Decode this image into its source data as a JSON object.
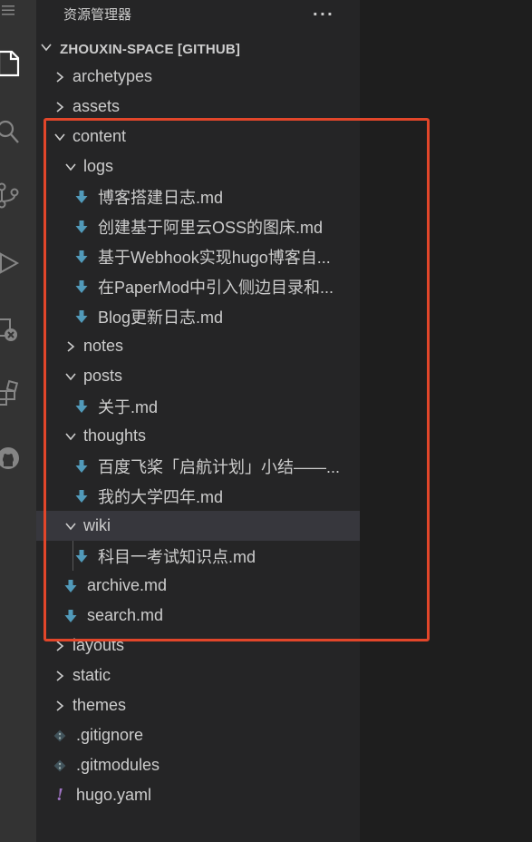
{
  "explorer": {
    "title": "资源管理器",
    "more_label": "···",
    "section_title": "ZHOUXIN-SPACE [GITHUB]"
  },
  "activity_bar": {
    "menu_icon": "hamburger-menu-icon",
    "items": [
      "explorer-icon",
      "search-icon",
      "source-control-icon",
      "run-debug-icon",
      "remote-explorer-icon",
      "extensions-icon",
      "github-icon"
    ]
  },
  "tree": [
    {
      "label": "archetypes",
      "type": "folder",
      "expanded": false,
      "depth": 0
    },
    {
      "label": "assets",
      "type": "folder",
      "expanded": false,
      "depth": 0
    },
    {
      "label": "content",
      "type": "folder",
      "expanded": true,
      "depth": 0
    },
    {
      "label": "logs",
      "type": "folder",
      "expanded": true,
      "depth": 1
    },
    {
      "label": "博客搭建日志.md",
      "type": "markdown",
      "depth": 2
    },
    {
      "label": "创建基于阿里云OSS的图床.md",
      "type": "markdown",
      "depth": 2
    },
    {
      "label": "基于Webhook实现hugo博客自...",
      "type": "markdown",
      "depth": 2
    },
    {
      "label": "在PaperMod中引入侧边目录和...",
      "type": "markdown",
      "depth": 2
    },
    {
      "label": "Blog更新日志.md",
      "type": "markdown",
      "depth": 2
    },
    {
      "label": "notes",
      "type": "folder",
      "expanded": false,
      "depth": 1
    },
    {
      "label": "posts",
      "type": "folder",
      "expanded": true,
      "depth": 1
    },
    {
      "label": "关于.md",
      "type": "markdown",
      "depth": 2
    },
    {
      "label": "thoughts",
      "type": "folder",
      "expanded": true,
      "depth": 1
    },
    {
      "label": "百度飞桨「启航计划」小结——...",
      "type": "markdown",
      "depth": 2
    },
    {
      "label": "我的大学四年.md",
      "type": "markdown",
      "depth": 2
    },
    {
      "label": "wiki",
      "type": "folder",
      "expanded": true,
      "depth": 1,
      "selected": true
    },
    {
      "label": "科目一考试知识点.md",
      "type": "markdown",
      "depth": 2
    },
    {
      "label": "archive.md",
      "type": "markdown",
      "depth": 1
    },
    {
      "label": "search.md",
      "type": "markdown",
      "depth": 1
    },
    {
      "label": "layouts",
      "type": "folder",
      "expanded": false,
      "depth": 0
    },
    {
      "label": "static",
      "type": "folder",
      "expanded": false,
      "depth": 0
    },
    {
      "label": "themes",
      "type": "folder",
      "expanded": false,
      "depth": 0
    },
    {
      "label": ".gitignore",
      "type": "git",
      "depth": 0
    },
    {
      "label": ".gitmodules",
      "type": "git",
      "depth": 0
    },
    {
      "label": "hugo.yaml",
      "type": "yaml",
      "depth": 0
    }
  ],
  "colors": {
    "markdown_icon": "#519aba",
    "yaml_icon": "#a074c4",
    "git_icon": "#41535b",
    "highlight_box": "#e2462a"
  }
}
